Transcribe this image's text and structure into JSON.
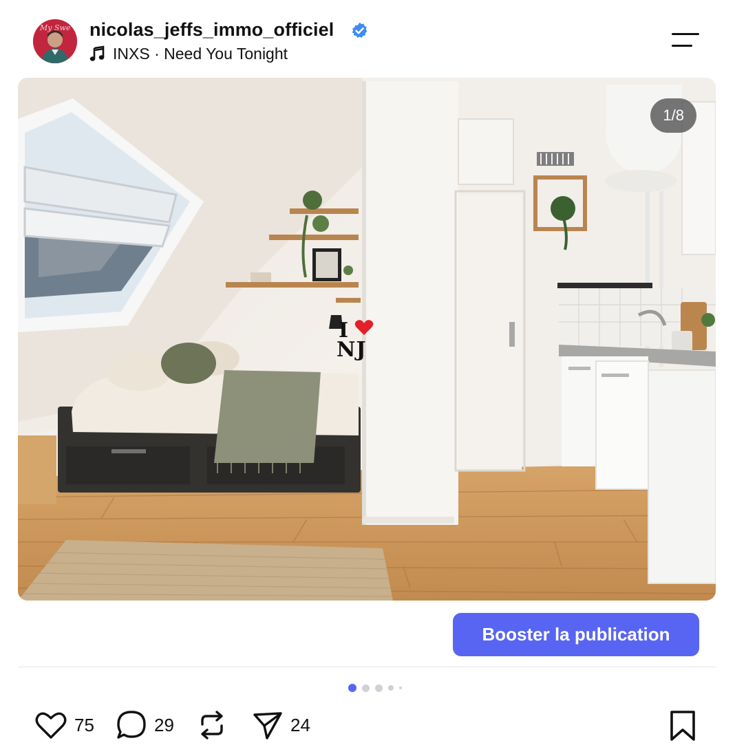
{
  "post": {
    "username": "nicolas_jeffs_immo_officiel",
    "verified_icon": "verified-badge-icon",
    "music_icon": "music-note-icon",
    "music": "INXS · Need You Tonight",
    "menu_icon": "menu-icon",
    "avatar_text": "My Swe"
  },
  "media": {
    "counter": "1/8",
    "overlay": {
      "line1": "I",
      "heart": "heart",
      "line2": "NJ"
    }
  },
  "boost_label": "Booster la publication",
  "carousel": {
    "total": 5,
    "active": 0
  },
  "actions": {
    "like_count": "75",
    "comment_count": "29",
    "share_count": "24"
  },
  "colors": {
    "accent": "#5865f2",
    "verified": "#3f8cf3",
    "dot_active": "#5865f2",
    "dot_inactive": "#d0d0d6"
  }
}
